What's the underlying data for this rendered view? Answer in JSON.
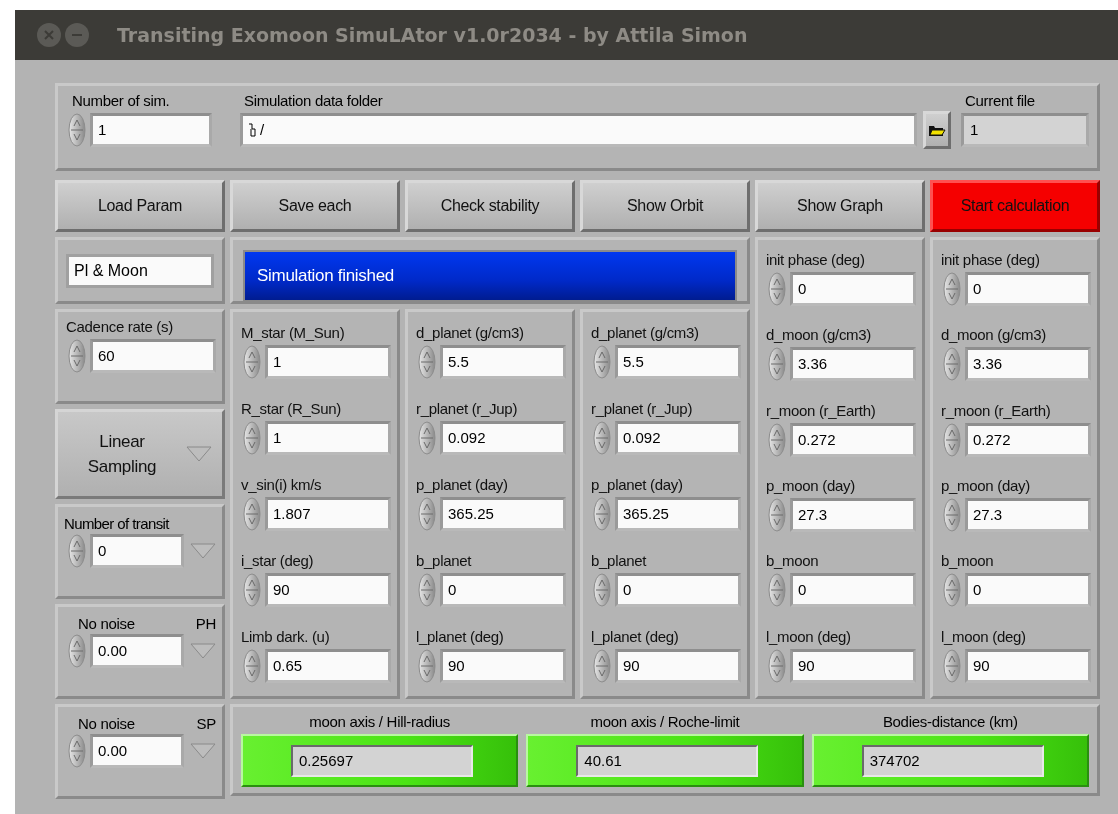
{
  "window": {
    "title": "Transiting Exomoon SimuLAtor v1.0r2034 - by Attila Simon"
  },
  "top_panel": {
    "number_of_sim": {
      "label": "Number of sim.",
      "value": "1"
    },
    "data_folder": {
      "label": "Simulation data folder",
      "value": "/"
    },
    "current_file": {
      "label": "Current file",
      "value": "1"
    }
  },
  "buttons": [
    {
      "label": "Load Param",
      "kind": "normal"
    },
    {
      "label": "Save each",
      "kind": "normal"
    },
    {
      "label": "Check stability",
      "kind": "normal"
    },
    {
      "label": "Show Orbit",
      "kind": "normal"
    },
    {
      "label": "Show Graph",
      "kind": "normal"
    },
    {
      "label": "Start calculation",
      "kind": "alert"
    }
  ],
  "left_panel": {
    "mode": "Pl & Moon",
    "cadence": {
      "label": "Cadence rate (s)",
      "value": "60"
    },
    "sampling": {
      "label": "Linear Sampling"
    },
    "transits": {
      "label": "Number of transit",
      "value": "0"
    },
    "noise_ph": {
      "label": "No noise",
      "tag": "PH",
      "value": "0.00"
    },
    "noise_sp": {
      "label": "No noise",
      "tag": "SP",
      "value": "0.00"
    }
  },
  "status": {
    "text": "Simulation finished"
  },
  "columns": [
    {
      "params": [
        {
          "label": "M_star (M_Sun)",
          "value": "1"
        },
        {
          "label": "R_star (R_Sun)",
          "value": "1"
        },
        {
          "label": "v_sin(i) km/s",
          "value": "1.807"
        },
        {
          "label": "i_star (deg)",
          "value": "90"
        },
        {
          "label": "Limb dark. (u)",
          "value": "0.65"
        }
      ]
    },
    {
      "params": [
        {
          "label": "d_planet (g/cm3)",
          "value": "5.5"
        },
        {
          "label": "r_planet (r_Jup)",
          "value": "0.092"
        },
        {
          "label": "p_planet (day)",
          "value": "365.25"
        },
        {
          "label": "b_planet",
          "value": "0"
        },
        {
          "label": "l_planet (deg)",
          "value": "90"
        }
      ]
    },
    {
      "params": [
        {
          "label": "d_planet (g/cm3)",
          "value": "5.5"
        },
        {
          "label": "r_planet (r_Jup)",
          "value": "0.092"
        },
        {
          "label": "p_planet (day)",
          "value": "365.25"
        },
        {
          "label": "b_planet",
          "value": "0"
        },
        {
          "label": "l_planet (deg)",
          "value": "90"
        }
      ]
    },
    {
      "params": [
        {
          "label": "init phase (deg)",
          "value": "0"
        },
        {
          "label": "d_moon (g/cm3)",
          "value": "3.36"
        },
        {
          "label": "r_moon (r_Earth)",
          "value": "0.272"
        },
        {
          "label": "p_moon (day)",
          "value": "27.3"
        },
        {
          "label": "b_moon",
          "value": "0"
        },
        {
          "label": "l_moon (deg)",
          "value": "90"
        }
      ]
    },
    {
      "params": [
        {
          "label": "init phase (deg)",
          "value": "0"
        },
        {
          "label": "d_moon (g/cm3)",
          "value": "3.36"
        },
        {
          "label": "r_moon (r_Earth)",
          "value": "0.272"
        },
        {
          "label": "p_moon (day)",
          "value": "27.3"
        },
        {
          "label": "b_moon",
          "value": "0"
        },
        {
          "label": "l_moon (deg)",
          "value": "90"
        }
      ]
    }
  ],
  "results": [
    {
      "label": "moon axis / Hill-radius",
      "value": "0.25697",
      "on": true
    },
    {
      "label": "moon axis / Roche-limit",
      "value": "40.61",
      "on": true
    },
    {
      "label": "Bodies-distance (km)",
      "value": "374702",
      "on": true
    }
  ]
}
